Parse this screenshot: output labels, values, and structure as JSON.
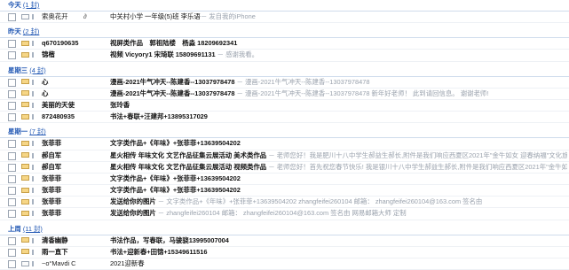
{
  "groups": [
    {
      "label": "今天",
      "count_text": "(1 封)",
      "rows": [
        {
          "sender": "索奥花开",
          "bold": false,
          "unread": false,
          "attach": true,
          "subject": "中关村小学 一年级(5)班 李乐语",
          "subject_bold": false,
          "preview": "－ 发自我的iPhone"
        }
      ]
    },
    {
      "label": "昨天",
      "count_text": "(2 封)",
      "rows": [
        {
          "sender": "q670190635",
          "bold": true,
          "unread": true,
          "attach": false,
          "subject": "视屏类作品　郭祖陆楼　杨淼 18209692341",
          "subject_bold": true,
          "preview": ""
        },
        {
          "sender": "锦楷",
          "bold": true,
          "unread": true,
          "attach": false,
          "subject": "视频 Vicyory1 宋琦联 15809691131",
          "subject_bold": true,
          "preview": " － 感谢我看。"
        }
      ]
    },
    {
      "label": "星期三",
      "count_text": "(4 封)",
      "rows": [
        {
          "sender": "心",
          "bold": true,
          "unread": true,
          "attach": false,
          "subject": "漫画-2021牛气冲天--陈建香--13037978478",
          "subject_bold": true,
          "preview": " － 漫画-2021牛气冲天--陈建香--13037978478"
        },
        {
          "sender": "心",
          "bold": true,
          "unread": true,
          "attach": false,
          "subject": "漫画-2021牛气冲天--陈建香--13037978478",
          "subject_bold": true,
          "preview": " － 漫画-2021牛气冲天--陈建香--13037978478 新年好老师！ 此到请回信息。 谢谢老师!"
        },
        {
          "sender": "美丽的天使",
          "bold": true,
          "unread": true,
          "attach": false,
          "subject": "张玲香",
          "subject_bold": true,
          "preview": ""
        },
        {
          "sender": "872480935",
          "bold": true,
          "unread": true,
          "attach": false,
          "subject": "书法+春联+汪建邦+13895317029",
          "subject_bold": true,
          "preview": ""
        }
      ]
    },
    {
      "label": "星期一",
      "count_text": "(7 封)",
      "rows": [
        {
          "sender": "张菲菲",
          "bold": true,
          "unread": true,
          "attach": false,
          "subject": "文字类作品+《年味》+张菲菲+13639504202",
          "subject_bold": true,
          "preview": ""
        },
        {
          "sender": "郝自军",
          "bold": true,
          "unread": true,
          "attach": false,
          "highlight": true,
          "subject": "星火相传 年味文化 文艺作品征集云展活动 美术类作品",
          "subject_bold": true,
          "preview": " － 老师您好！我是肥川十八中学生郝益生郝长,附件是我们响应西夏区2021年\"金牛如女 迎春纳福\"文化旅游休育区"
        },
        {
          "sender": "郝自军",
          "bold": true,
          "unread": true,
          "attach": false,
          "highlight": true,
          "subject": "星火相传 年味文化 文艺作品征集云展活动 视频类作品",
          "subject_bold": true,
          "preview": " － 老师您好！首先祝您春节快乐! 我是银川十八中学生郝益生郝长,附件是我们响应西夏区2021年\"金牛如女 迎春纳"
        },
        {
          "sender": "张菲菲",
          "bold": true,
          "unread": true,
          "attach": false,
          "subject": "文字类作品+《年味》+张菲菲+13639504202",
          "subject_bold": true,
          "preview": ""
        },
        {
          "sender": "张菲菲",
          "bold": true,
          "unread": true,
          "attach": false,
          "subject": "文字类作品+《年味》+张菲菲+13639504202",
          "subject_bold": true,
          "preview": ""
        },
        {
          "sender": "张菲菲",
          "bold": true,
          "unread": true,
          "attach": false,
          "subject": "发送给你的图片",
          "subject_bold": true,
          "preview": " － 文字类作品+《年味》+张菲菲+13639504202 zhangfeifei260104 邮箱： zhangfeifei260104@163.com 签名由"
        },
        {
          "sender": "张菲菲",
          "bold": true,
          "unread": true,
          "attach": false,
          "subject": "发送给你的图片",
          "subject_bold": true,
          "preview": " － zhangfeifei260104 邮箱： zhangfeifei260104@163.com 签名由 网易邮箱大师 定制"
        }
      ]
    },
    {
      "label": "上周",
      "count_text": "(11 封)",
      "rows": [
        {
          "sender": "清香幽静",
          "bold": true,
          "unread": true,
          "attach": false,
          "subject": "书法作品，写春联，马骏骁13995007004",
          "subject_bold": true,
          "preview": ""
        },
        {
          "sender": "雨一直下",
          "bold": true,
          "unread": true,
          "attach": false,
          "subject": "书法+迎新春+田锦+15349611516",
          "subject_bold": true,
          "preview": ""
        },
        {
          "sender": "~o°Mavdi C",
          "bold": false,
          "unread": false,
          "attach": false,
          "subject": "2021迎新春",
          "subject_bold": false,
          "preview": ""
        }
      ]
    }
  ],
  "icons": {
    "checkbox": "checkbox-icon",
    "envelope": "envelope-icon",
    "flag": "flag-icon",
    "attachment": "paperclip-icon"
  },
  "colors": {
    "group_header": "#1f56b3",
    "preview": "#9aa2ad",
    "unread_envelope": "#f6d686"
  }
}
